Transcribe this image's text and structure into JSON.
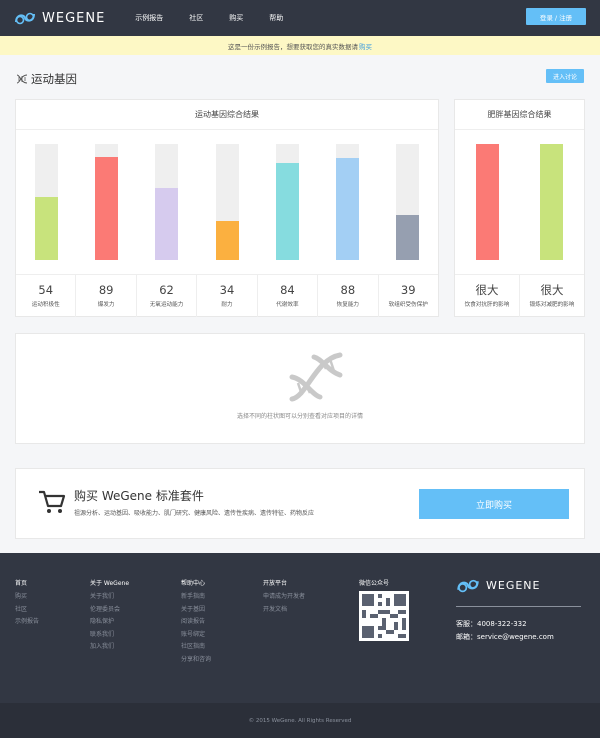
{
  "nav": {
    "logo_text": "WEGENE",
    "links": [
      "示例报告",
      "社区",
      "购买",
      "帮助"
    ],
    "login_label": "登录 / 注册"
  },
  "notice": {
    "text": "这是一份示例报告，想要获取您的真实数据请",
    "link": "购买"
  },
  "page": {
    "title": "运动基因",
    "discuss_label": "进入讨论"
  },
  "sports_card": {
    "title": "运动基因综合结果",
    "items": [
      {
        "label": "运动积极性",
        "value": "54",
        "level": 54,
        "color": "#c8e37c"
      },
      {
        "label": "爆发力",
        "value": "89",
        "level": 89,
        "color": "#fb7a75"
      },
      {
        "label": "无氧运动能力",
        "value": "62",
        "level": 62,
        "color": "#d6cbee"
      },
      {
        "label": "耐力",
        "value": "34",
        "level": 34,
        "color": "#fbb040"
      },
      {
        "label": "代谢效率",
        "value": "84",
        "level": 84,
        "color": "#86dcdf"
      },
      {
        "label": "恢复能力",
        "value": "88",
        "level": 88,
        "color": "#a3cff4"
      },
      {
        "label": "软组织受伤保护",
        "value": "39",
        "level": 39,
        "color": "#969fb0"
      }
    ]
  },
  "obesity_card": {
    "title": "肥胖基因综合结果",
    "items": [
      {
        "label": "饮食对抗肝的影响",
        "value": "很大",
        "level": 100,
        "color": "#fb7a75"
      },
      {
        "label": "锻炼对减肥的影响",
        "value": "很大",
        "level": 100,
        "color": "#c8e37c"
      }
    ]
  },
  "detail": {
    "hint": "选择不同的柱状图可以分别查看对应项目的详情"
  },
  "buy": {
    "title": "购买 WeGene 标准套件",
    "subtitle": "祖源分析、运动基因、吸收能力、肌门研究、健康风险、遗传性疾病、遗传特征、药物反应",
    "button": "立即购买"
  },
  "footer": {
    "columns": [
      {
        "title": "首页",
        "items": [
          "购买",
          "社区",
          "示例报告"
        ]
      },
      {
        "title": "关于 WeGene",
        "items": [
          "关于我们",
          "伦理委员会",
          "隐私保护",
          "联系我们",
          "加入我们"
        ]
      },
      {
        "title": "帮助中心",
        "items": [
          "新手指南",
          "关于基因",
          "阅读报告",
          "账号绑定",
          "社区指南",
          "分享和咨询"
        ]
      },
      {
        "title": "开放平台",
        "items": [
          "申请成为开发者",
          "开发文档"
        ]
      },
      {
        "title": "微信公众号",
        "items": []
      }
    ],
    "logo_text": "WEGENE",
    "phone": "客服：4008-322-332",
    "email": "邮箱：service@wegene.com",
    "copyright": "© 2015 WeGene. All Rights Reserved"
  }
}
